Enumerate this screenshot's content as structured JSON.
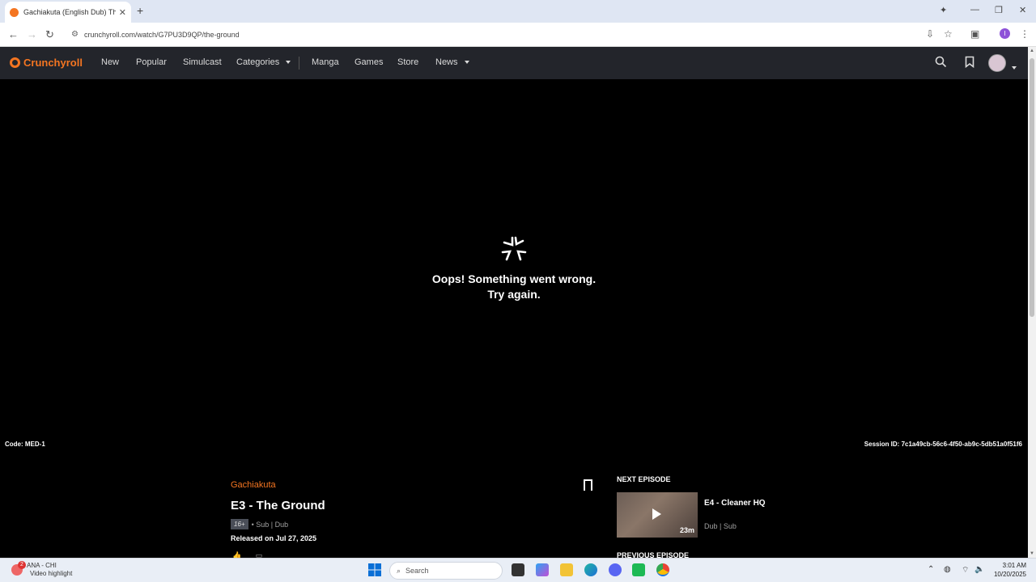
{
  "browser": {
    "tab_title": "Gachiakuta (English Dub) The G",
    "tab_close": "✕",
    "new_tab": "+",
    "url": "crunchyroll.com/watch/G7PU3D9QP/the-ground"
  },
  "nav": {
    "logo": "Crunchyroll",
    "items": [
      "New",
      "Popular",
      "Simulcast",
      "Categories",
      "Manga",
      "Games",
      "Store",
      "News"
    ]
  },
  "error": {
    "line1": "Oops! Something went wrong.",
    "line2": "Try again."
  },
  "footer_info": {
    "code": "Code: MED-1",
    "session": "Session ID: 7c1a49cb-56c6-4f50-ab9c-5db51a0f51f6"
  },
  "episode": {
    "series": "Gachiakuta",
    "title": "E3 - The Ground",
    "rating": "16+",
    "audio": "• Sub | Dub",
    "released": "Released on Jul 27, 2025"
  },
  "next_episode": {
    "heading": "NEXT EPISODE",
    "title": "E4 - Cleaner HQ",
    "duration": "23m",
    "audio": "Dub | Sub"
  },
  "previous_episode": {
    "heading": "PREVIOUS EPISODE"
  },
  "taskbar": {
    "weather_label": "ANA - CHI",
    "weather_sub": "Video highlight",
    "weather_badge": "2",
    "search": "Search",
    "time": "3:01 AM",
    "date": "10/20/2025"
  },
  "colors": {
    "brand": "#f47521",
    "nav_bg": "#23252b"
  }
}
